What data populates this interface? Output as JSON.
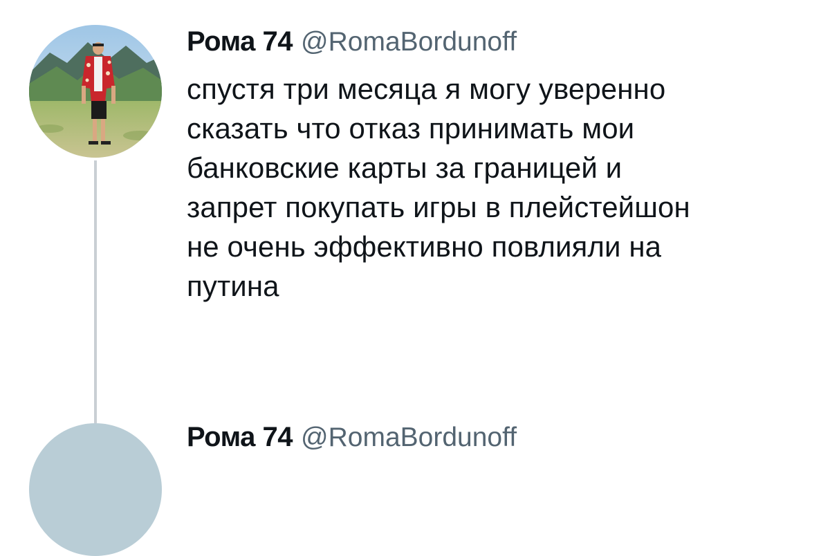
{
  "tweet": {
    "display_name": "Рома 74",
    "handle": "@RomaBordunoff",
    "text": "спустя три месяца я могу уверенно\nсказать что отказ принимать мои\nбанковские карты за границей и\nзапрет покупать игры в плейстейшон\nне очень эффективно повлияли на\nпутина"
  },
  "next_tweet": {
    "display_name": "Рома 74",
    "handle": "@RomaBordunoff"
  },
  "colors": {
    "text": "#0f1419",
    "secondary": "#536471",
    "thread_line": "#c9cfd4"
  }
}
